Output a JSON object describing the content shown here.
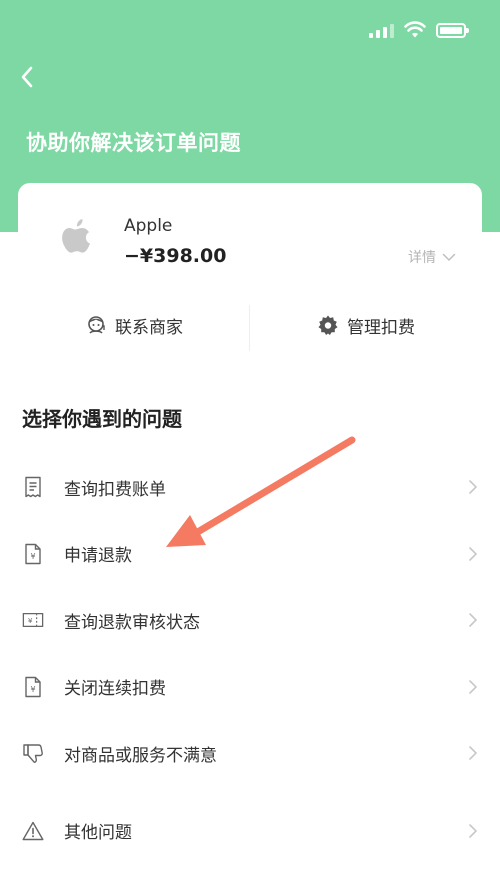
{
  "colors": {
    "header_green": "#7dd8a3",
    "annotation_arrow": "#f47a62"
  },
  "header": {
    "title": "协助你解决该订单问题",
    "back_icon": "chevron-left-icon"
  },
  "order": {
    "merchant": "Apple",
    "amount": "−¥398.00",
    "details_label": "详情"
  },
  "actions": [
    {
      "label": "联系商家",
      "icon": "merchant-avatar-icon"
    },
    {
      "label": "管理扣费",
      "icon": "gear-icon"
    }
  ],
  "section_title": "选择你遇到的问题",
  "issues": [
    {
      "label": "查询扣费账单",
      "icon": "receipt-icon"
    },
    {
      "label": "申请退款",
      "icon": "refund-document-icon"
    },
    {
      "label": "查询退款审核状态",
      "icon": "refund-status-icon"
    },
    {
      "label": "关闭连续扣费",
      "icon": "yuan-document-icon"
    },
    {
      "label": "对商品或服务不满意",
      "icon": "thumbs-down-icon"
    },
    {
      "label": "其他问题",
      "icon": "warning-icon"
    }
  ]
}
